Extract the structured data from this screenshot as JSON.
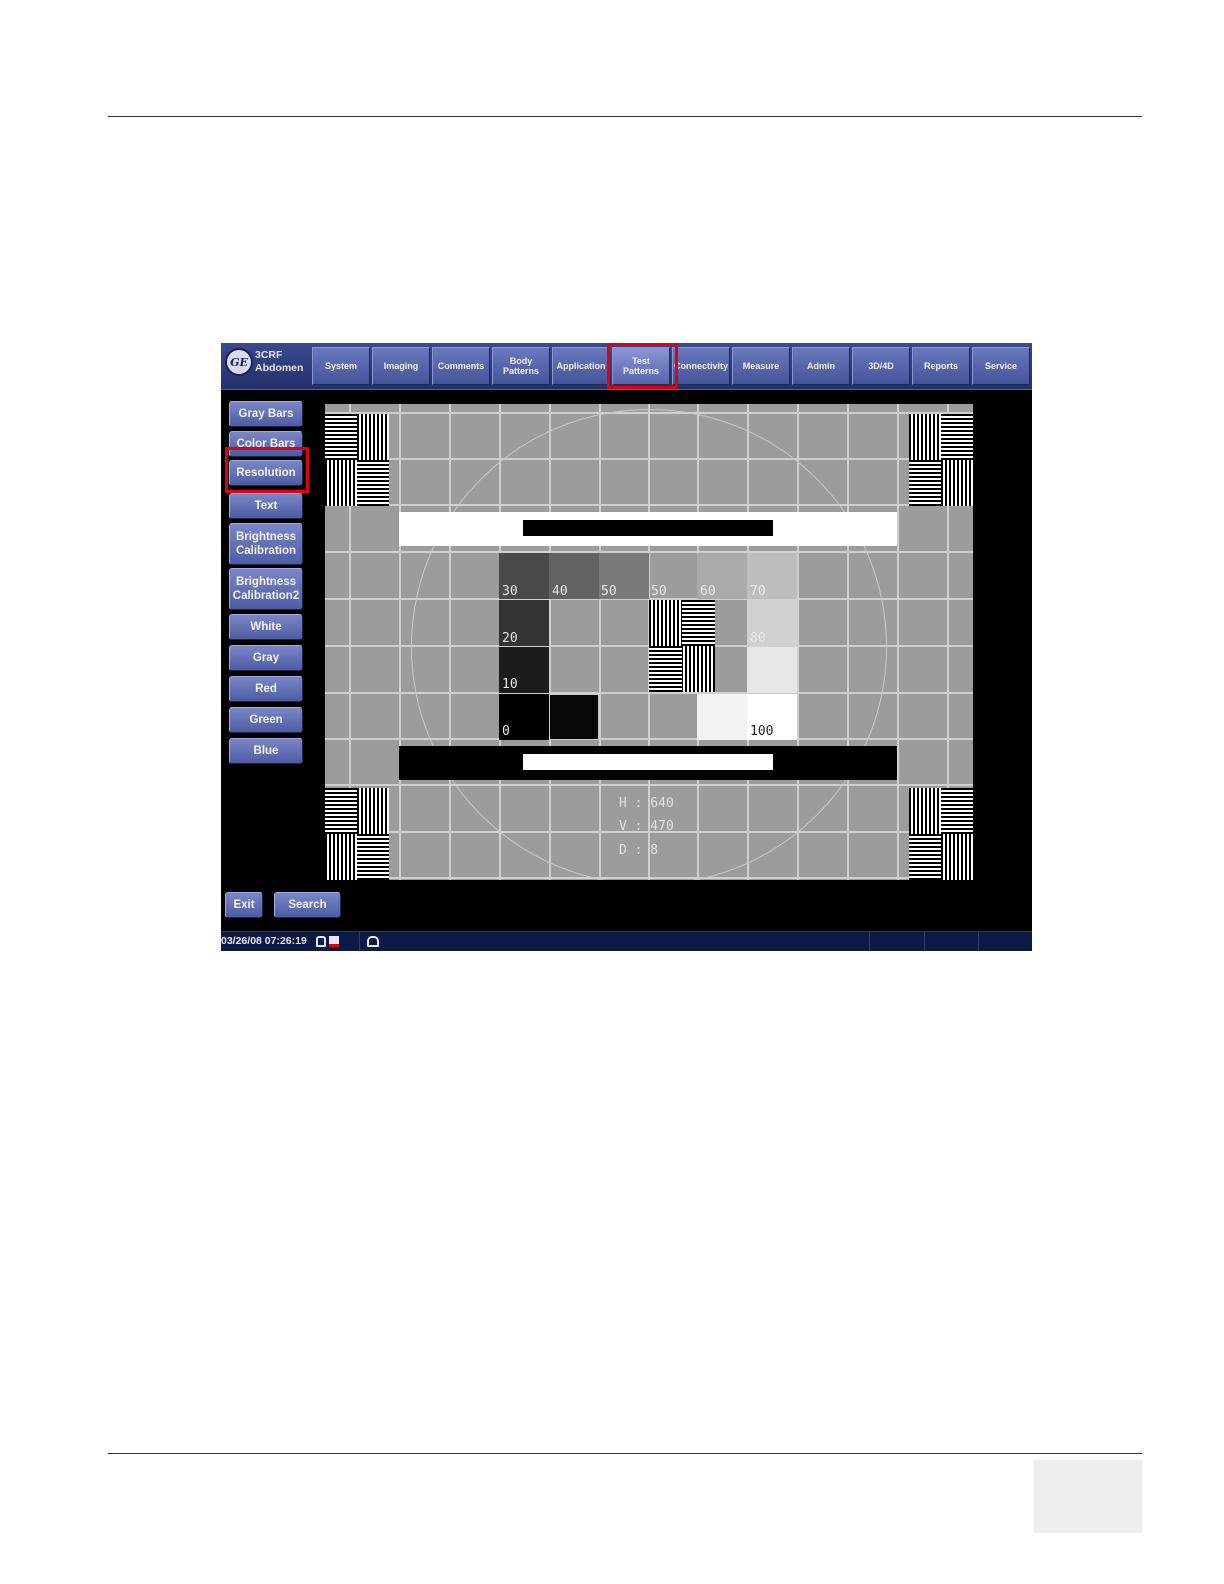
{
  "app": {
    "probe_line1": "3CRF",
    "probe_line2": "Abdomen",
    "logo_text": "GE",
    "active_tab": "Test Patterns",
    "active_pattern": "Resolution",
    "highlight_color": "#e00010"
  },
  "tabs": [
    {
      "label": "System"
    },
    {
      "label": "Imaging"
    },
    {
      "label": "Comments"
    },
    {
      "label": "Body Patterns"
    },
    {
      "label": "Application"
    },
    {
      "label": "Test Patterns"
    },
    {
      "label": "Connectivity"
    },
    {
      "label": "Measure"
    },
    {
      "label": "Admin"
    },
    {
      "label": "3D/4D"
    },
    {
      "label": "Reports"
    },
    {
      "label": "Service"
    }
  ],
  "sidebar": {
    "buttons": [
      {
        "label": "Gray Bars"
      },
      {
        "label": "Color Bars"
      },
      {
        "label": "Resolution"
      },
      {
        "label": "Text"
      },
      {
        "label": "Brightness Calibration"
      },
      {
        "label": "Brightness Calibration2"
      },
      {
        "label": "White"
      },
      {
        "label": "Gray"
      },
      {
        "label": "Red"
      },
      {
        "label": "Green"
      },
      {
        "label": "Blue"
      }
    ]
  },
  "pattern": {
    "labels": [
      "30",
      "40",
      "50",
      "50",
      "60",
      "70",
      "20",
      "80",
      "10",
      "90",
      "0",
      "100"
    ],
    "info": {
      "h": "H : 640",
      "v": "V : 470",
      "d": "D : 8"
    }
  },
  "bottom": {
    "exit_label": "Exit",
    "search_label": "Search"
  },
  "status": {
    "timestamp": "03/26/08 07:26:19"
  }
}
